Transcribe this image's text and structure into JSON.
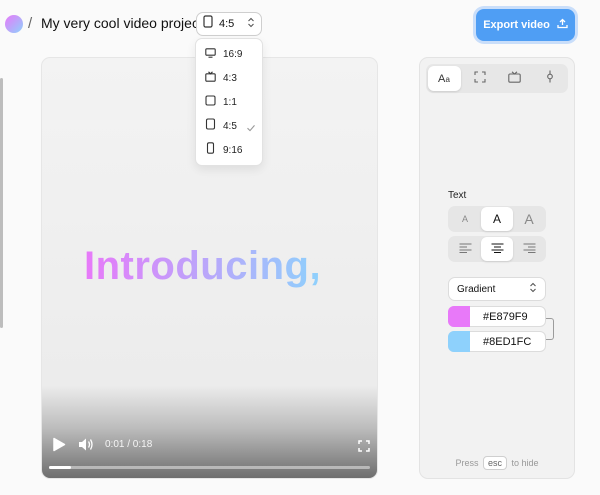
{
  "header": {
    "separator": "/",
    "project_title": "My very cool video project",
    "ratio_value": "4:5",
    "export_label": "Export video"
  },
  "ratio_options": [
    {
      "label": "16:9",
      "icon": "monitor-icon",
      "selected": false
    },
    {
      "label": "4:3",
      "icon": "tv-icon",
      "selected": false
    },
    {
      "label": "1:1",
      "icon": "square-icon",
      "selected": false
    },
    {
      "label": "4:5",
      "icon": "portrait-icon",
      "selected": true
    },
    {
      "label": "9:16",
      "icon": "phone-icon",
      "selected": false
    }
  ],
  "video": {
    "headline": "Introducing,",
    "time": "0:01 / 0:18",
    "progress": 0.07,
    "gradient_start": "#E879F9",
    "gradient_end": "#8ED1FC"
  },
  "panel": {
    "tabs": [
      "text-style-icon",
      "crop-icon",
      "tv-icon",
      "keyframe-icon"
    ],
    "active_tab": 0,
    "section_label": "Text",
    "size_options": [
      "A",
      "A",
      "A"
    ],
    "active_size": 1,
    "align_options": [
      "align-left-icon",
      "align-center-icon",
      "align-right-icon"
    ],
    "active_align": 1,
    "fill_mode": "Gradient",
    "color_1": "#E879F9",
    "color_2": "#8ED1FC",
    "hint_prefix": "Press",
    "hint_key": "esc",
    "hint_suffix": "to hide"
  }
}
